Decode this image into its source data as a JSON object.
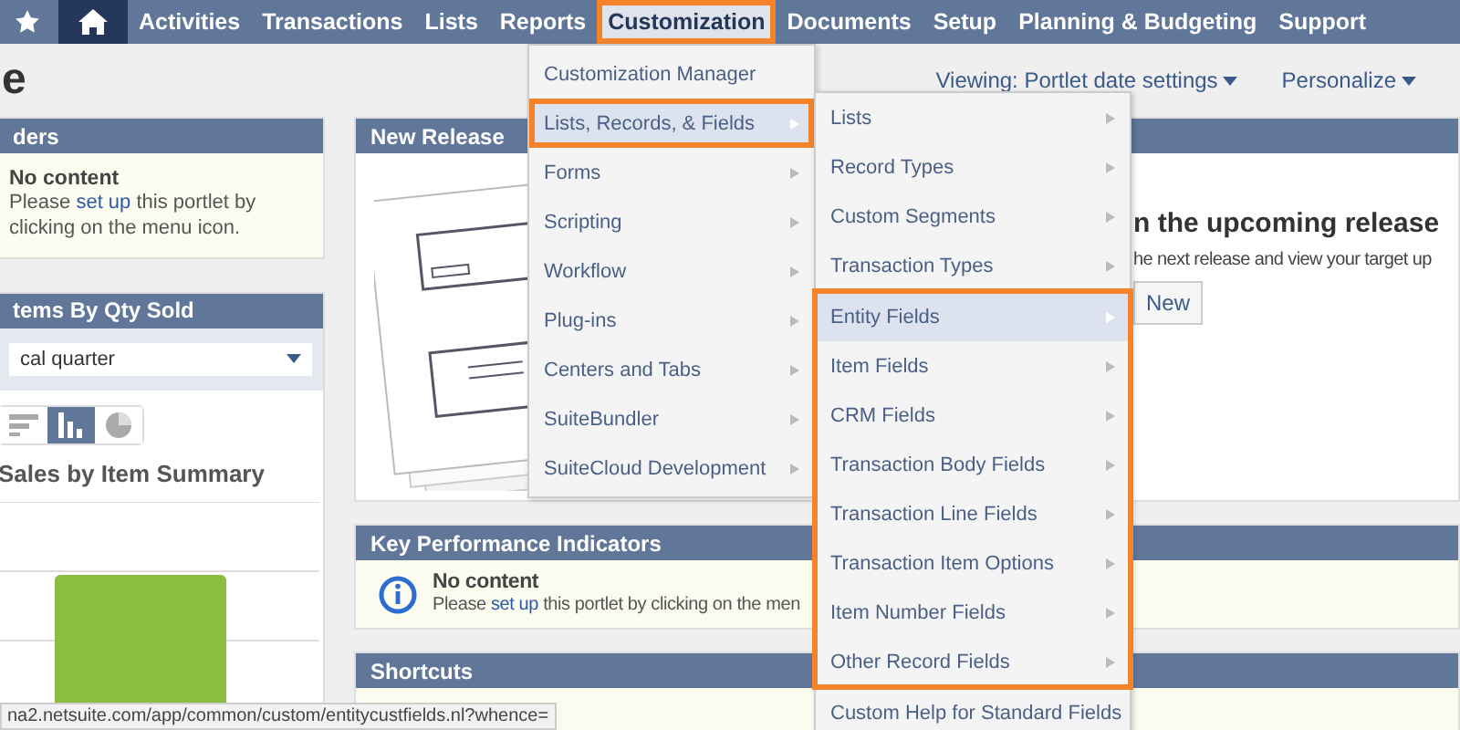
{
  "nav": {
    "items": [
      {
        "kind": "star",
        "selected": false,
        "outlined": false
      },
      {
        "kind": "home",
        "selected": false,
        "outlined": false
      },
      {
        "kind": "text",
        "label": "Activities",
        "selected": false,
        "outlined": false
      },
      {
        "kind": "text",
        "label": "Transactions",
        "selected": false,
        "outlined": false
      },
      {
        "kind": "text",
        "label": "Lists",
        "selected": false,
        "outlined": false
      },
      {
        "kind": "text",
        "label": "Reports",
        "selected": false,
        "outlined": false
      },
      {
        "kind": "text",
        "label": "Customization",
        "selected": true,
        "outlined": true
      },
      {
        "kind": "text",
        "label": "Documents",
        "selected": false,
        "outlined": false
      },
      {
        "kind": "text",
        "label": "Setup",
        "selected": false,
        "outlined": false
      },
      {
        "kind": "text",
        "label": "Planning & Budgeting",
        "selected": false,
        "outlined": false
      },
      {
        "kind": "text",
        "label": "Support",
        "selected": false,
        "outlined": false
      }
    ]
  },
  "page_title": "e",
  "header_links": [
    "Viewing: Portlet date settings",
    "Personalize"
  ],
  "left_portlets": [
    {
      "kind": "message",
      "title": "ders",
      "message_title": "No content",
      "message": "Please **set up** this portlet by clicking on the menu icon."
    },
    {
      "kind": "chart",
      "title": "tems By Qty Sold",
      "select_value": "cal quarter",
      "chart_types": [
        {
          "kind": "horizontal",
          "selected": false
        },
        {
          "kind": "column",
          "selected": true
        },
        {
          "kind": "pie",
          "selected": false
        }
      ],
      "chart_title": "Sales by Item Summary"
    }
  ],
  "main_portlets": [
    {
      "kind": "release",
      "title": "New Release",
      "heading": "n the upcoming release",
      "text": "he next release and view your target up",
      "button": "New"
    },
    {
      "kind": "message",
      "title": "Key Performance Indicators",
      "message_title": "No content",
      "message": "Please **set up** this portlet by clicking on the men"
    },
    {
      "kind": "empty",
      "title": "Shortcuts"
    }
  ],
  "menu": {
    "items": [
      {
        "label": "Customization Manager",
        "submenu": false,
        "selected": false,
        "outlined": false
      },
      {
        "label": "Lists, Records, & Fields",
        "submenu": true,
        "selected": true,
        "outlined": true
      },
      {
        "label": "Forms",
        "submenu": true,
        "selected": false,
        "outlined": false
      },
      {
        "label": "Scripting",
        "submenu": true,
        "selected": false,
        "outlined": false
      },
      {
        "label": "Workflow",
        "submenu": true,
        "selected": false,
        "outlined": false
      },
      {
        "label": "Plug-ins",
        "submenu": true,
        "selected": false,
        "outlined": false
      },
      {
        "label": "Centers and Tabs",
        "submenu": true,
        "selected": false,
        "outlined": false
      },
      {
        "label": "SuiteBundler",
        "submenu": true,
        "selected": false,
        "outlined": false
      },
      {
        "label": "SuiteCloud Development",
        "submenu": true,
        "selected": false,
        "outlined": false
      }
    ]
  },
  "submenu": {
    "sections": [
      {
        "outlined": false,
        "items": [
          {
            "label": "Lists",
            "submenu": true,
            "selected": false
          },
          {
            "label": "Record Types",
            "submenu": true,
            "selected": false
          },
          {
            "label": "Custom Segments",
            "submenu": true,
            "selected": false
          },
          {
            "label": "Transaction Types",
            "submenu": true,
            "selected": false
          }
        ]
      },
      {
        "outlined": true,
        "items": [
          {
            "label": "Entity Fields",
            "submenu": true,
            "selected": true
          },
          {
            "label": "Item Fields",
            "submenu": true,
            "selected": false
          },
          {
            "label": "CRM Fields",
            "submenu": true,
            "selected": false
          },
          {
            "label": "Transaction Body Fields",
            "submenu": true,
            "selected": false
          },
          {
            "label": "Transaction Line Fields",
            "submenu": true,
            "selected": false
          },
          {
            "label": "Transaction Item Options",
            "submenu": true,
            "selected": false
          },
          {
            "label": "Item Number Fields",
            "submenu": true,
            "selected": false
          },
          {
            "label": "Other Record Fields",
            "submenu": true,
            "selected": false
          }
        ]
      },
      {
        "outlined": false,
        "items": [
          {
            "label": "Custom Help for Standard Fields",
            "submenu": false,
            "selected": false
          }
        ]
      }
    ]
  },
  "status_url": "na2.netsuite.com/app/common/custom/entitycustfields.nl?whence="
}
